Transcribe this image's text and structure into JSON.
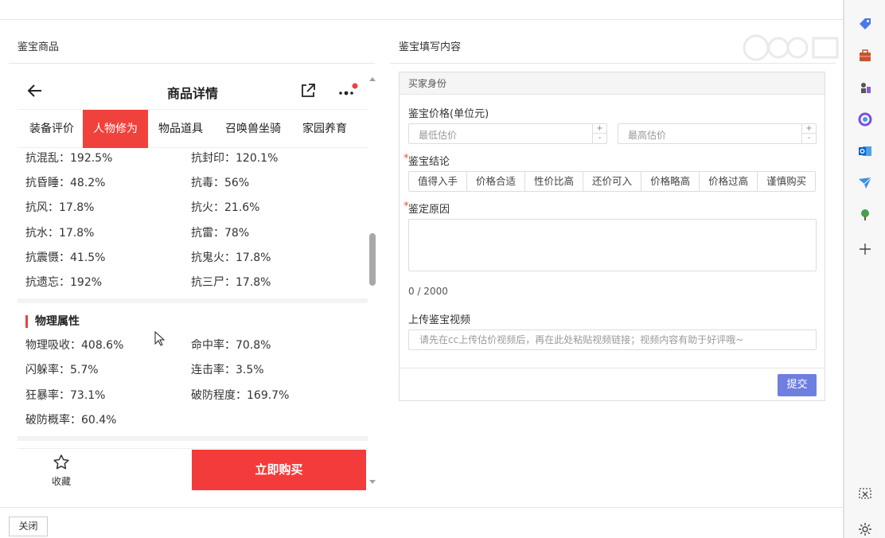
{
  "left_panel": {
    "title": "鉴宝商品"
  },
  "right_panel": {
    "title": "鉴宝填写内容"
  },
  "phone": {
    "header_title": "商品详情",
    "tabs": [
      "装备评价",
      "人物修为",
      "物品道具",
      "召唤兽坐骑",
      "家园养育"
    ],
    "active_tab": 1,
    "resist_attrs": [
      [
        "抗混乱：192.5%",
        "抗封印：120.1%"
      ],
      [
        "抗昏睡：48.2%",
        "抗毒：56%"
      ],
      [
        "抗风：17.8%",
        "抗火：21.6%"
      ],
      [
        "抗水：17.8%",
        "抗雷：78%"
      ],
      [
        "抗震慑：41.5%",
        "抗鬼火：17.8%"
      ],
      [
        "抗遗忘：192%",
        "抗三尸：17.8%"
      ]
    ],
    "physical_title": "物理属性",
    "physical_attrs": [
      [
        "物理吸收：408.6%",
        "命中率：70.8%"
      ],
      [
        "闪躲率：5.7%",
        "连击率：3.5%"
      ],
      [
        "狂暴率：73.1%",
        "破防程度：169.7%"
      ],
      [
        "破防概率：60.4%",
        ""
      ]
    ],
    "favorite_label": "收藏",
    "buy_label": "立即购买"
  },
  "form": {
    "section_head": "买家身份",
    "price_label": "鉴宝价格(单位元)",
    "min_placeholder": "最低估价",
    "max_placeholder": "最高估价",
    "conclusion_label": "鉴宝结论",
    "conclusion_options": [
      "值得入手",
      "价格合适",
      "性价比高",
      "还价可入",
      "价格略高",
      "价格过高",
      "谨慎购买"
    ],
    "reason_label": "鉴定原因",
    "counter": "0 / 2000",
    "video_label": "上传鉴宝视频",
    "video_placeholder": "请先在cc上传估价视频后，再在此处粘贴视频链接；视频内容有助于好评哦~",
    "submit_label": "提交"
  },
  "close_label": "关闭",
  "colors": {
    "accent_red": "#f0413c",
    "submit_blue": "#6f7fe0"
  }
}
